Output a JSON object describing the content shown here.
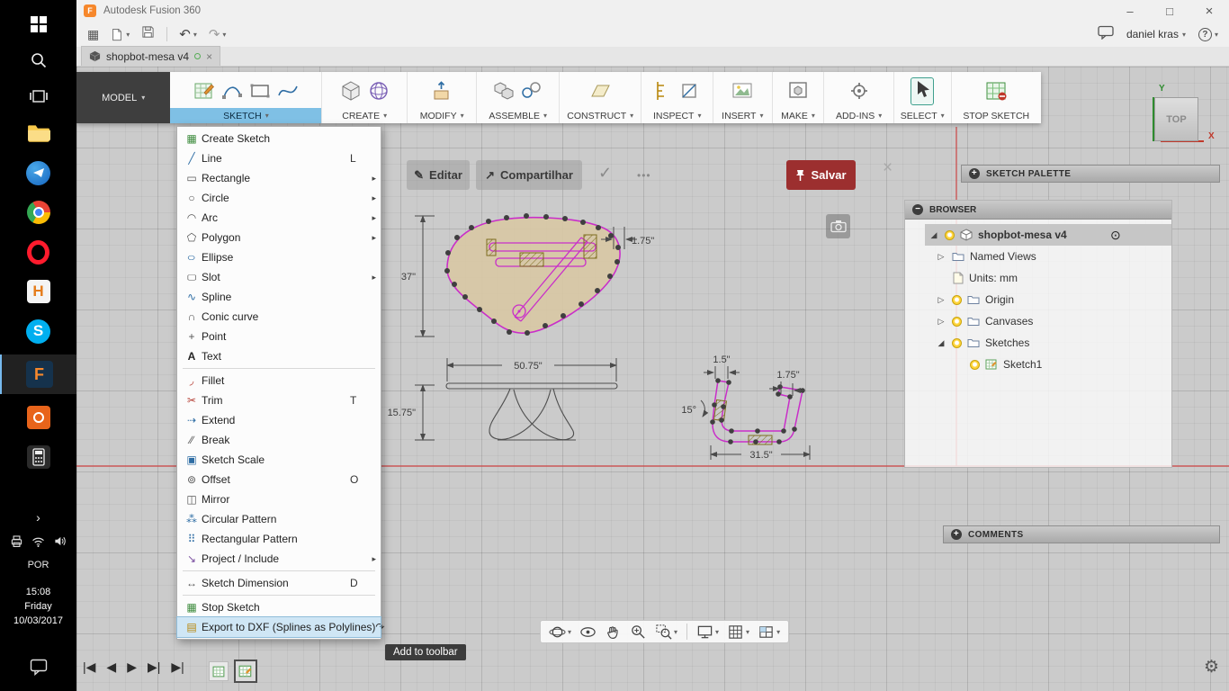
{
  "window": {
    "logo_letter": "F",
    "title": "Autodesk Fusion 360",
    "minimize": "–",
    "maximize": "□",
    "close": "×"
  },
  "ui": {
    "caret": "▾",
    "gear": "⚙"
  },
  "qat": {
    "grid_glyph": "▦",
    "undo": "↶",
    "redo": "↷",
    "user": "daniel kras",
    "help": "?"
  },
  "tab": {
    "title": "shopbot-mesa v4",
    "close": "×"
  },
  "toolbar": {
    "model_label": "MODEL",
    "groups": [
      {
        "label": "SKETCH"
      },
      {
        "label": "CREATE"
      },
      {
        "label": "MODIFY"
      },
      {
        "label": "ASSEMBLE"
      },
      {
        "label": "CONSTRUCT"
      },
      {
        "label": "INSPECT"
      },
      {
        "label": "INSERT"
      },
      {
        "label": "MAKE"
      },
      {
        "label": "ADD-INS"
      },
      {
        "label": "SELECT"
      },
      {
        "label": "STOP SKETCH"
      }
    ]
  },
  "menu": {
    "items": [
      {
        "label": "Create Sketch",
        "glyph": "▦"
      },
      {
        "label": "Line",
        "shortcut": "L",
        "glyph": "╱"
      },
      {
        "label": "Rectangle",
        "arrow": "▸",
        "glyph": "▭"
      },
      {
        "label": "Circle",
        "arrow": "▸",
        "glyph": "○"
      },
      {
        "label": "Arc",
        "arrow": "▸",
        "glyph": "◠"
      },
      {
        "label": "Polygon",
        "arrow": "▸",
        "glyph": "⬠"
      },
      {
        "label": "Ellipse",
        "glyph": "○"
      },
      {
        "label": "Slot",
        "arrow": "▸",
        "glyph": "▢"
      },
      {
        "label": "Spline",
        "glyph": "∿"
      },
      {
        "label": "Conic curve",
        "glyph": "∩"
      },
      {
        "label": "Point",
        "glyph": "+"
      },
      {
        "label": "Text",
        "glyph": "A"
      },
      {
        "label": "Fillet",
        "glyph": "◞"
      },
      {
        "label": "Trim",
        "shortcut": "T",
        "glyph": "✂"
      },
      {
        "label": "Extend",
        "glyph": "⇢"
      },
      {
        "label": "Break",
        "glyph": "∕∕"
      },
      {
        "label": "Sketch Scale",
        "glyph": "▣"
      },
      {
        "label": "Offset",
        "shortcut": "O",
        "glyph": "⊚"
      },
      {
        "label": "Mirror",
        "glyph": "◫"
      },
      {
        "label": "Circular Pattern",
        "glyph": "⁂"
      },
      {
        "label": "Rectangular Pattern",
        "glyph": "⠿"
      },
      {
        "label": "Project / Include",
        "arrow": "▸",
        "glyph": "↘"
      },
      {
        "label": "Sketch Dimension",
        "shortcut": "D",
        "glyph": "↔"
      },
      {
        "label": "Stop Sketch",
        "glyph": "▦"
      },
      {
        "label": "Export to DXF (Splines as Polylines)",
        "glyph": "▤",
        "trail": "↷"
      }
    ]
  },
  "tooltip": {
    "label": "Add to toolbar"
  },
  "overlay": {
    "edit": "Editar",
    "edit_icon": "✎",
    "share": "Compartilhar",
    "share_icon": "↗",
    "check": "✓",
    "more": "•••",
    "save": "Salvar",
    "close": "×"
  },
  "viewcube": {
    "face": "TOP",
    "y_axis": "Y",
    "x_axis": "X"
  },
  "panels": {
    "sketch_palette": {
      "title": "SKETCH PALETTE",
      "icon": "+"
    },
    "comments": {
      "title": "COMMENTS",
      "icon": "+"
    },
    "browser": {
      "title": "BROWSER",
      "icon": "−",
      "activate": "⊙",
      "items": [
        {
          "expander": "◢",
          "label": "shopbot-mesa v4"
        },
        {
          "expander": "▷",
          "label": "Named Views"
        },
        {
          "label": "Units: mm"
        },
        {
          "expander": "▷",
          "label": "Origin"
        },
        {
          "expander": "▷",
          "label": "Canvases"
        },
        {
          "expander": "◢",
          "label": "Sketches"
        },
        {
          "label": "Sketch1"
        }
      ]
    }
  },
  "sketch": {
    "dims": {
      "height": "37\"",
      "slot_width": "1.75\"",
      "table_width": "50.75\"",
      "table_height": "15.75\"",
      "leg_top": "1.5\"",
      "leg_hook": "1.75\"",
      "leg_angle": "15°",
      "leg_width": "31.5\""
    }
  },
  "timeline": {
    "controls": [
      "|◀",
      "◀",
      "▶",
      "▶|",
      "▶|"
    ]
  },
  "taskbar": {
    "language": "POR",
    "time": "15:08",
    "weekday": "Friday",
    "date": "10/03/2017",
    "f_label": "F",
    "h_label": "H",
    "s_label": "S",
    "chevron": "›"
  }
}
